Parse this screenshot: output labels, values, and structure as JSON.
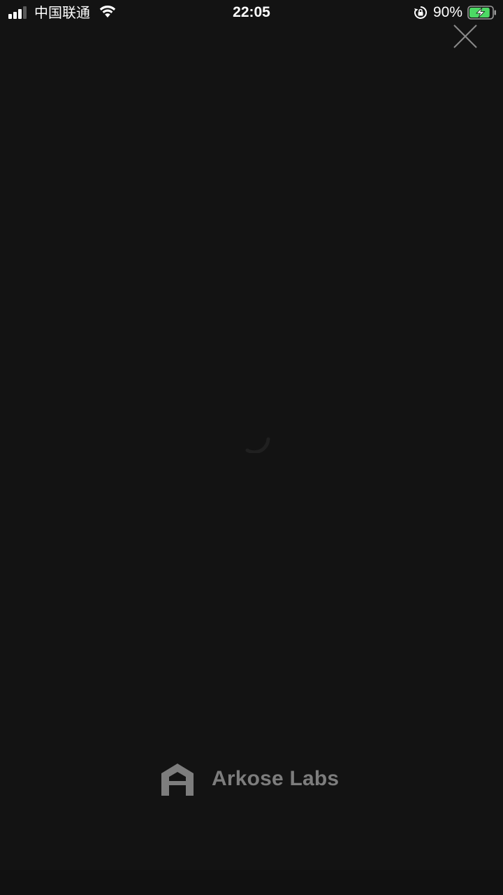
{
  "status_bar": {
    "carrier": "中国联通",
    "time": "22:05",
    "battery_percent": "90%",
    "battery_level": 0.9,
    "charging": true,
    "signal_bars": 3
  },
  "colors": {
    "background": "#131313",
    "battery_fill": "#4cd964",
    "brand_text": "#7d7d7d",
    "close_icon": "#8a8a8a"
  },
  "icons": {
    "signal": "signal-icon",
    "wifi": "wifi-icon",
    "rotation_lock": "rotation-lock-icon",
    "battery": "battery-charging-icon",
    "close": "close-icon",
    "spinner": "loading-spinner-icon",
    "brand_logo": "arkose-logo-icon"
  },
  "branding": {
    "name": "Arkose Labs"
  }
}
